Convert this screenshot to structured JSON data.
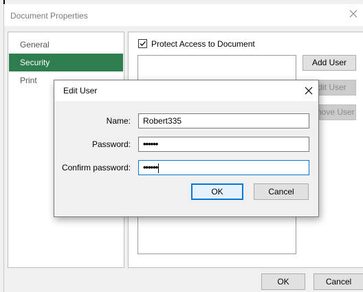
{
  "outer_window": {
    "title": "Document Properties",
    "close_icon": "close-icon",
    "nav": {
      "items": [
        {
          "label": "General"
        },
        {
          "label": "Security",
          "selected": true
        },
        {
          "label": "Print"
        }
      ]
    },
    "security": {
      "protect_label": "Protect Access to Document",
      "protect_checked": true,
      "add_user_label": "Add User",
      "edit_user_label": "Edit User",
      "remove_user_label": "Remove User"
    },
    "ok_label": "OK",
    "cancel_label": "Cancel",
    "accent_color": "#2e7d4f"
  },
  "edit_user_dialog": {
    "title": "Edit User",
    "close_icon": "close-icon",
    "name_label": "Name:",
    "name_value": "Robert335",
    "password_label": "Password:",
    "password_value": "••••••",
    "confirm_label": "Confirm password:",
    "confirm_value": "••••••",
    "ok_label": "OK",
    "cancel_label": "Cancel",
    "focus_color": "#0078d7"
  }
}
